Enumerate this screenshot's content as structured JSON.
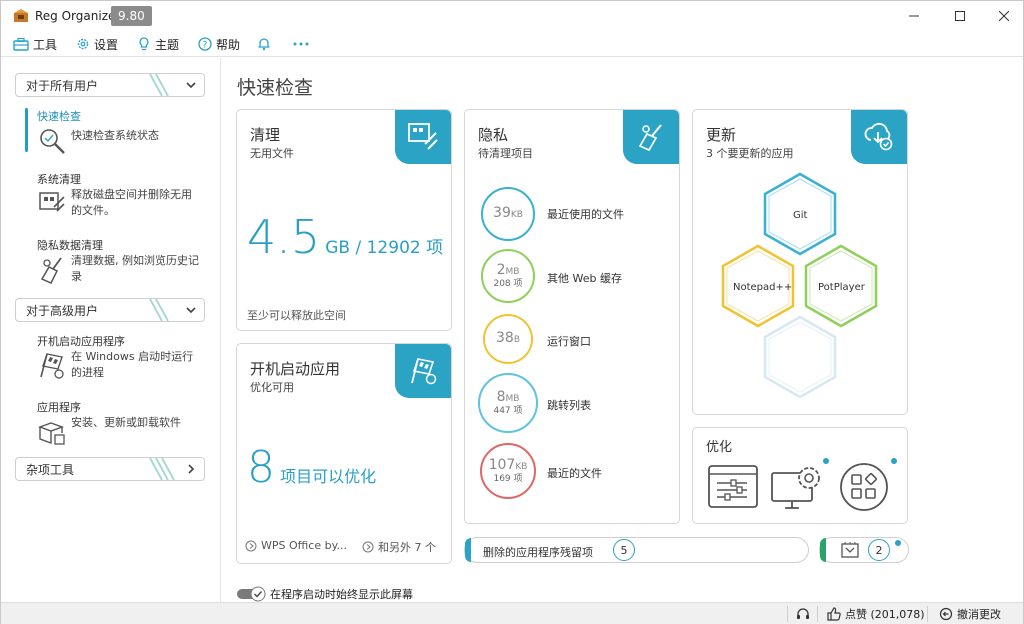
{
  "app": {
    "title": "Reg Organizer",
    "version": "9.80"
  },
  "menu": {
    "tools": "工具",
    "settings": "设置",
    "theme": "主题",
    "help": "帮助"
  },
  "sidebar": {
    "group_all_users": "对于所有用户",
    "group_advanced": "对于高级用户",
    "group_misc": "杂项工具",
    "items": [
      {
        "title": "快速检查",
        "desc": "快速检查系统状态"
      },
      {
        "title": "系统清理",
        "desc": "释放磁盘空间并删除无用的文件。"
      },
      {
        "title": "隐私数据清理",
        "desc": "清理数据, 例如浏览历史记录"
      },
      {
        "title": "开机启动应用程序",
        "desc": "在 Windows 启动时运行的进程"
      },
      {
        "title": "应用程序",
        "desc": "安装、更新或卸载软件"
      }
    ]
  },
  "main": {
    "title": "快速检查",
    "cleanup": {
      "title": "清理",
      "subtitle": "无用文件",
      "size_value": "4.5",
      "size_unit": "GB / 12902 项",
      "footer": "至少可以释放此空间"
    },
    "startup": {
      "title": "开机启动应用",
      "subtitle": "优化可用",
      "count": "8",
      "count_text": "项目可以优化",
      "app1": "WPS Office by...",
      "app2": "和另外 7 个"
    },
    "privacy": {
      "title": "隐私",
      "subtitle": "待清理项目",
      "items": [
        {
          "value": "39",
          "unit": "KB",
          "sub": "",
          "label": "最近使用的文件",
          "color": "#39b1d1"
        },
        {
          "value": "2",
          "unit": "MB",
          "sub": "208 项",
          "label": "其他 Web 缓存",
          "color": "#8fcf5b"
        },
        {
          "value": "38",
          "unit": "B",
          "sub": "",
          "label": "运行窗口",
          "color": "#f1c232"
        },
        {
          "value": "8",
          "unit": "MB",
          "sub": "447 项",
          "label": "跳转列表",
          "color": "#5fc3e0"
        },
        {
          "value": "107",
          "unit": "KB",
          "sub": "169 项",
          "label": "最近的文件",
          "color": "#e06666"
        }
      ]
    },
    "updates": {
      "title": "更新",
      "subtitle": "3 个要更新的应用",
      "apps": [
        "Git",
        "Notepad++",
        "PotPlayer"
      ]
    },
    "optimize": {
      "title": "优化"
    },
    "leftovers": {
      "label": "删除的应用程序残留项",
      "count": "5"
    },
    "extra": {
      "count": "2"
    },
    "startup_toggle": "在程序启动时始终显示此屏幕"
  },
  "status": {
    "likes": "点赞 (201,078)",
    "undo": "撤消更改"
  },
  "colors": {
    "accent": "#2aa3c5"
  }
}
